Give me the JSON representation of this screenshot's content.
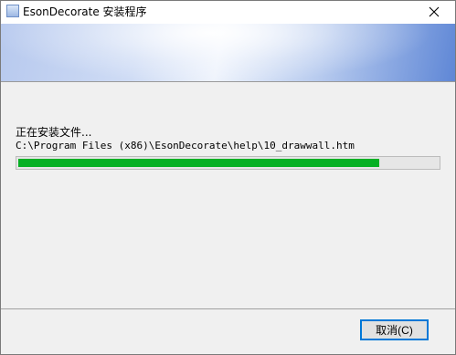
{
  "window": {
    "title": "EsonDecorate 安装程序"
  },
  "install": {
    "status": "正在安装文件...",
    "current_file": "C:\\Program Files (x86)\\EsonDecorate\\help\\10_drawwall.htm",
    "progress_fraction": 0.86
  },
  "buttons": {
    "cancel_label": "取消(C)"
  },
  "icons": {
    "app": "installer-icon",
    "close": "close-icon"
  },
  "colors": {
    "progress_fill": "#06b025",
    "banner_accent": "#5f87d6",
    "focus_border": "#0078d7"
  }
}
